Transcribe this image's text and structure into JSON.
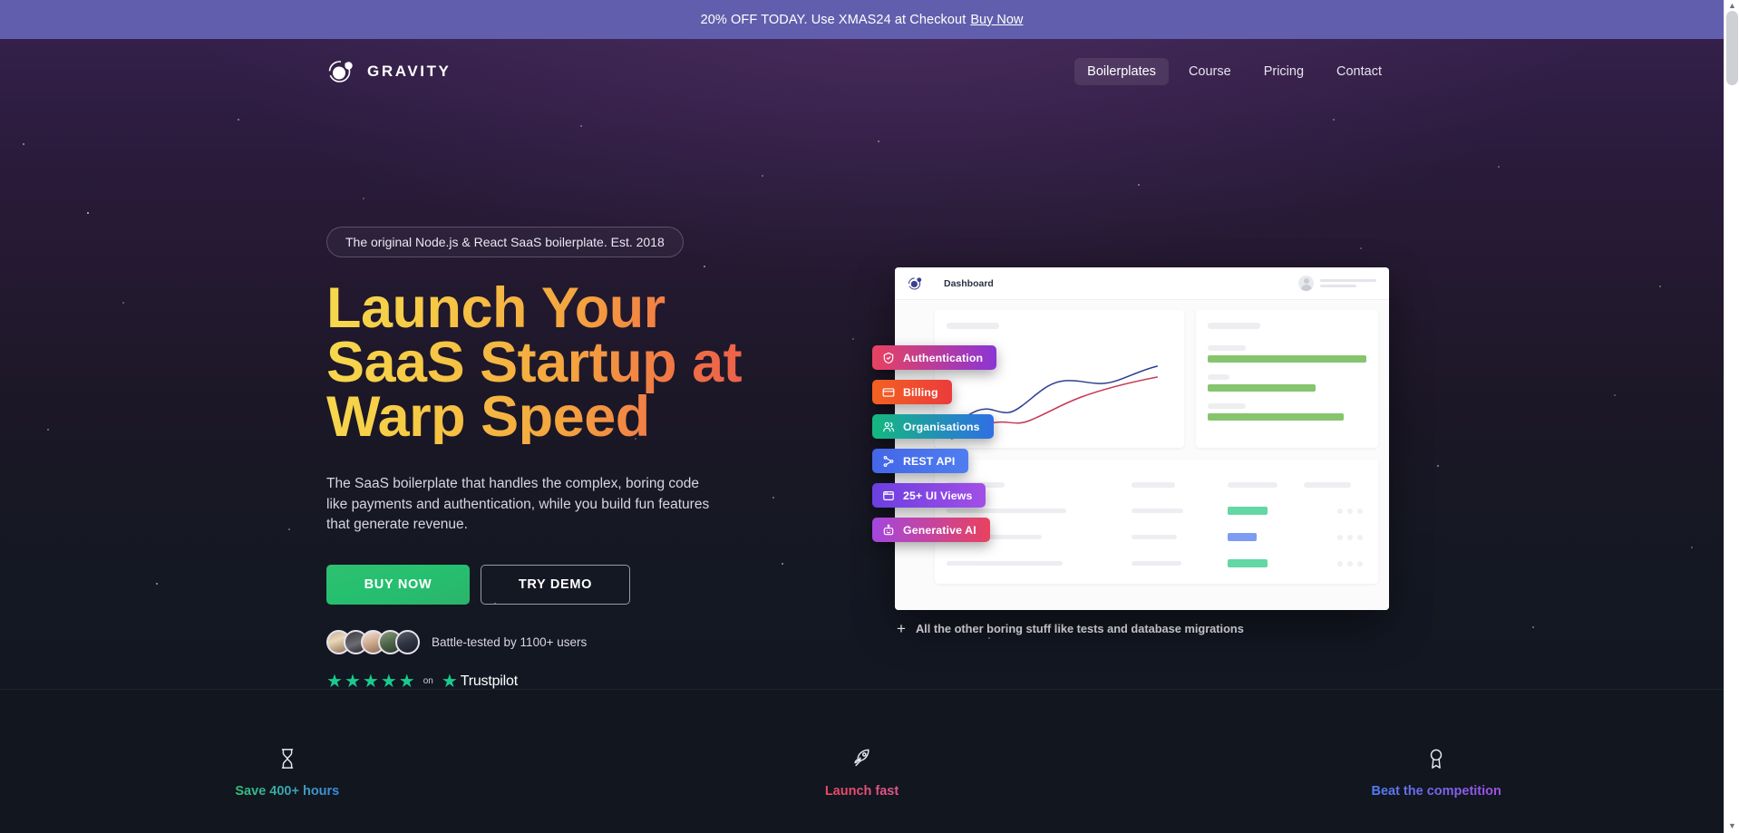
{
  "promo": {
    "text": "20% OFF TODAY. Use XMAS24 at Checkout",
    "link_label": "Buy Now",
    "bg": "#615fad"
  },
  "header": {
    "brand": "GRAVITY",
    "nav": [
      {
        "label": "Boilerplates",
        "active": true
      },
      {
        "label": "Course",
        "active": false
      },
      {
        "label": "Pricing",
        "active": false
      },
      {
        "label": "Contact",
        "active": false
      }
    ]
  },
  "hero": {
    "eyebrow": "The original Node.js & React SaaS boilerplate. Est. 2018",
    "title": "Launch Your SaaS Startup at Warp Speed",
    "title_gradient_from": "#f6d94e",
    "title_gradient_to": "#e8544f",
    "subtitle": "The SaaS boilerplate that handles the complex, boring code like payments and authentication, while you build fun features that generate revenue.",
    "primary_cta": "BUY NOW",
    "primary_cta_color": "#2abd6e",
    "secondary_cta": "TRY DEMO",
    "social_proof": "Battle-tested by 1100+ users",
    "rating": {
      "stars": 5,
      "on_label": "on",
      "brand": "Trustpilot",
      "star_color": "#19cb8d"
    }
  },
  "mockup": {
    "app_title": "Dashboard",
    "footnote": "All the other boring stuff like tests and database migrations",
    "feature_pills": [
      {
        "label": "Authentication",
        "icon": "shield-check-icon",
        "from": "#e8425f",
        "to": "#8b35d6"
      },
      {
        "label": "Billing",
        "icon": "credit-card-icon",
        "from": "#f26122",
        "to": "#ec3b3b"
      },
      {
        "label": "Organisations",
        "icon": "users-icon",
        "from": "#14b87f",
        "to": "#2f6fe4"
      },
      {
        "label": "REST API",
        "icon": "api-node-icon",
        "from": "#4466e8",
        "to": "#4f7ef0"
      },
      {
        "label": "25+ UI Views",
        "icon": "window-icon",
        "from": "#6b3fe0",
        "to": "#a24fe6"
      },
      {
        "label": "Generative AI",
        "icon": "robot-icon",
        "from": "#a347dd",
        "to": "#e8425f"
      }
    ],
    "chart": {
      "line_a_color": "#2f3f8f",
      "line_b_color": "#c53a52"
    },
    "bars": [
      {
        "width_pct": 100,
        "color": "#86c46e"
      },
      {
        "width_pct": 68,
        "color": "#86c46e"
      },
      {
        "width_pct": 86,
        "color": "#86c46e"
      }
    ],
    "table_rows": [
      {
        "badge_color": "#63d7a4",
        "badge_width": 30
      },
      {
        "badge_color": "#7b9cf2",
        "badge_width": 22
      },
      {
        "badge_color": "#63d7a4",
        "badge_width": 30
      }
    ]
  },
  "features": [
    {
      "label": "Save 400+ hours",
      "icon": "hourglass-icon",
      "from": "#34c27a",
      "to": "#3f8ae0"
    },
    {
      "label": "Launch fast",
      "icon": "rocket-icon",
      "from": "#e8495f",
      "to": "#e0558e"
    },
    {
      "label": "Beat the competition",
      "icon": "medal-icon",
      "from": "#4f7ef0",
      "to": "#a24fe6"
    }
  ]
}
